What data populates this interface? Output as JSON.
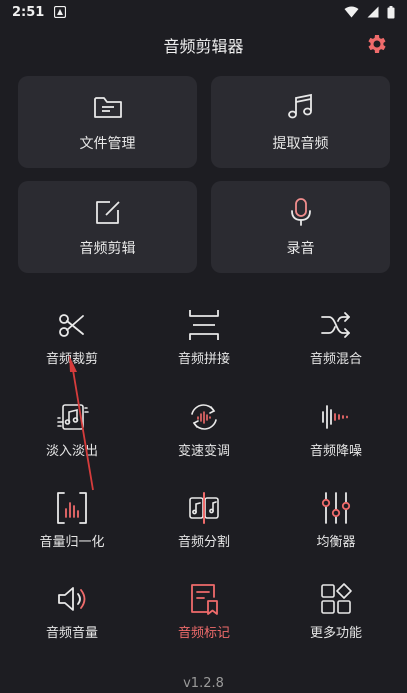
{
  "status_bar": {
    "time": "2:51"
  },
  "header": {
    "title": "音频剪辑器"
  },
  "cards": [
    {
      "label": "文件管理",
      "icon": "folder-icon"
    },
    {
      "label": "提取音频",
      "icon": "music-note-icon"
    },
    {
      "label": "音频剪辑",
      "icon": "edit-icon"
    },
    {
      "label": "录音",
      "icon": "microphone-icon"
    }
  ],
  "tools": [
    {
      "label": "音频裁剪",
      "icon": "scissors-icon"
    },
    {
      "label": "音频拼接",
      "icon": "join-icon"
    },
    {
      "label": "音频混合",
      "icon": "shuffle-icon"
    },
    {
      "label": "淡入淡出",
      "icon": "fade-icon"
    },
    {
      "label": "变速变调",
      "icon": "speed-icon"
    },
    {
      "label": "音频降噪",
      "icon": "denoise-icon"
    },
    {
      "label": "音量归一化",
      "icon": "normalize-icon"
    },
    {
      "label": "音频分割",
      "icon": "split-icon"
    },
    {
      "label": "均衡器",
      "icon": "equalizer-icon"
    },
    {
      "label": "音频音量",
      "icon": "volume-icon"
    },
    {
      "label": "音频标记",
      "icon": "bookmark-icon"
    },
    {
      "label": "更多功能",
      "icon": "more-icon"
    }
  ],
  "footer": {
    "version": "v1.2.8"
  },
  "colors": {
    "background": "#1d1d22",
    "card": "#2b2b31",
    "accent": "#ef6b6b",
    "microphone": "#f08d8d"
  }
}
